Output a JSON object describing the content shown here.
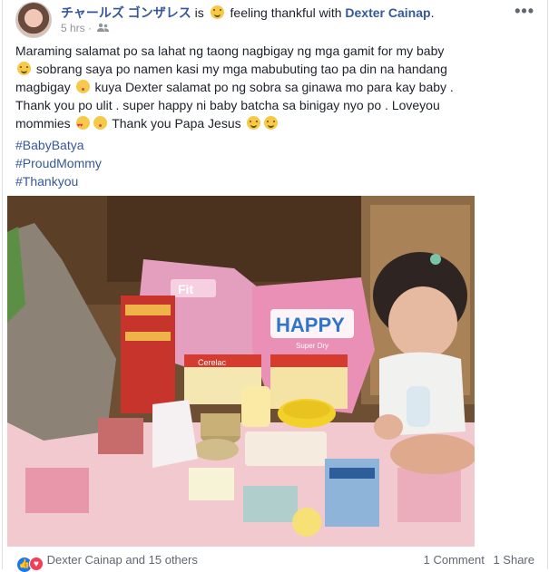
{
  "header": {
    "author": "チャールズ ゴンザレス",
    "is_word": "is",
    "feeling": "feeling thankful with",
    "tagged": "Dexter Cainap",
    "period": ".",
    "time": "5 hrs",
    "separator": "·",
    "more": "•••"
  },
  "post": {
    "line1": "Maraming salamat po sa lahat ng taong nagbigay ng mga gamit for my baby",
    "line2": "sobrang saya po namen kasi my mga mabubuting tao pa din na handang",
    "line3a": "magbigay",
    "line3b": "kuya Dexter salamat po ng sobra sa ginawa mo para kay baby .",
    "line4": "Thank you po ulit . super happy ni baby batcha sa binigay nyo po . Loveyou",
    "line5a": "mommies",
    "line5b": "Thank you Papa Jesus",
    "hashtags": [
      "#BabyBatya",
      "#ProudMommy",
      "#Thankyou"
    ]
  },
  "photo": {
    "label_left": "HAPPY",
    "label_small": "Super Dry",
    "box_label": "Cerelac",
    "pack_label": "Fit"
  },
  "footer": {
    "reactions_text": "Dexter Cainap and 15 others",
    "comments": "1 Comment",
    "shares": "1 Share"
  },
  "colors": {
    "link": "#365899",
    "text": "#1d2129",
    "muted": "#90949c",
    "like": "#1877f2",
    "love": "#f33e58"
  }
}
